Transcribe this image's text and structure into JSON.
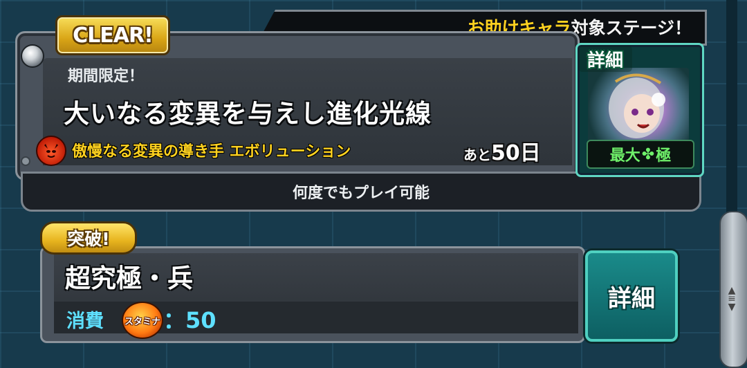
{
  "stage_card": {
    "clear_badge": "CLEAR!",
    "helper_banner_highlight": "お助けキャラ",
    "helper_banner_rest": "対象ステージ！",
    "period_label": "期間限定！",
    "title": "大いなる変異を与えし進化光線",
    "boss_name": "傲慢なる変異の導き手 エボリューション",
    "days_prefix": "あと",
    "days_value": "50日",
    "playable_text": "何度でもプレイ可能",
    "detail_tag": "詳細",
    "max_badge_left": "最大",
    "max_badge_clover": "✤",
    "max_badge_right": "極"
  },
  "quest_card": {
    "break_badge": "突破!",
    "title": "超究極・兵",
    "cost_label": "消費",
    "stamina_icon_text": "スタミナ",
    "stamina_value": "：50",
    "detail_button": "詳細"
  },
  "scrollbar": {
    "grip_up": "▲",
    "grip_lines": "≡",
    "grip_down": "▼"
  },
  "colors": {
    "accent_gold": "#ffd21f",
    "accent_cyan": "#5ee0ff",
    "accent_green": "#6ff06a",
    "teal_button": "#1a8b8a"
  }
}
